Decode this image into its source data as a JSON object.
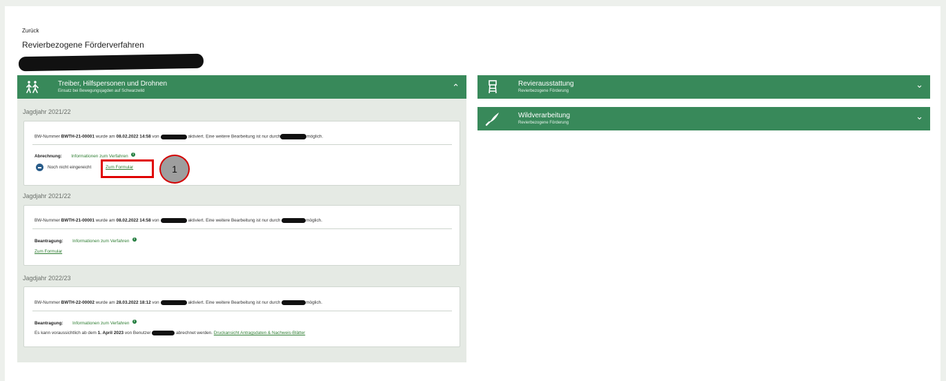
{
  "page": {
    "back_label": "Zurück",
    "title": "Revierbezogene Förderverfahren"
  },
  "panels": {
    "treiber": {
      "title": "Treiber, Hilfspersonen und Drohnen",
      "subtitle": "Einsatz bei Bewegungsjagden auf Schwarzwild",
      "icon": "people-walking-icon",
      "expanded": true,
      "chevron": "⌃"
    },
    "revier": {
      "title": "Revierausstattung",
      "subtitle": "Revierbezogene Förderung",
      "icon": "hunting-stand-icon",
      "chevron": "⌄"
    },
    "wild": {
      "title": "Wildverarbeitung",
      "subtitle": "Revierbezogene Förderung",
      "icon": "knife-icon",
      "chevron": "⌄"
    }
  },
  "entries": [
    {
      "year": "Jagdjahr 2021/22",
      "pre": "BW-Nummer ",
      "number": "BWTH-21-00001",
      "mid": " wurde am ",
      "date": "08.02.2022 14:58",
      "von": " von ",
      "after": "aktiviert. Eine weitere Bearbeitung ist nur durch",
      "end": "möglich.",
      "label": "Abrechnung:",
      "info_link": "Informationen zum Verfahren",
      "status": "Noch nicht eingereicht",
      "form_link": "Zum Formular"
    },
    {
      "year": "Jagdjahr 2021/22",
      "pre": "BW-Nummer ",
      "number": "BWTH-21-00001",
      "mid": " wurde am ",
      "date": "08.02.2022 14:58",
      "von": " von ",
      "after": "aktiviert. Eine weitere Bearbeitung ist nur durch ",
      "end": "möglich.",
      "label": "Beantragung:",
      "info_link": "Informationen zum Verfahren",
      "form_link": "Zum Formular"
    },
    {
      "year": "Jagdjahr 2022/23",
      "pre": "BW-Nummer ",
      "number": "BWTH-22-00002",
      "mid": " wurde am ",
      "date": "28.03.2022 18:12",
      "von": " von ",
      "after": "aktiviert. Eine weitere Bearbeitung ist nur durch ",
      "end": "möglich.",
      "label": "Beantragung:",
      "info_link": "Informationen zum Verfahren",
      "note_pre": "Es kann voraussichtlich ab dem ",
      "note_date": "1. April 2023",
      "note_mid": " von Benutzer ",
      "note_post": " abrechnet werden. ",
      "print_link": "Druckansicht Antragsdaten & Nachweis-Blätter"
    }
  ],
  "annotation": {
    "marker": "1"
  },
  "colors": {
    "header_green": "#38895a",
    "panel_bg": "#e5eae4",
    "link_green": "#2e7d32",
    "highlight_red": "#e00000"
  }
}
